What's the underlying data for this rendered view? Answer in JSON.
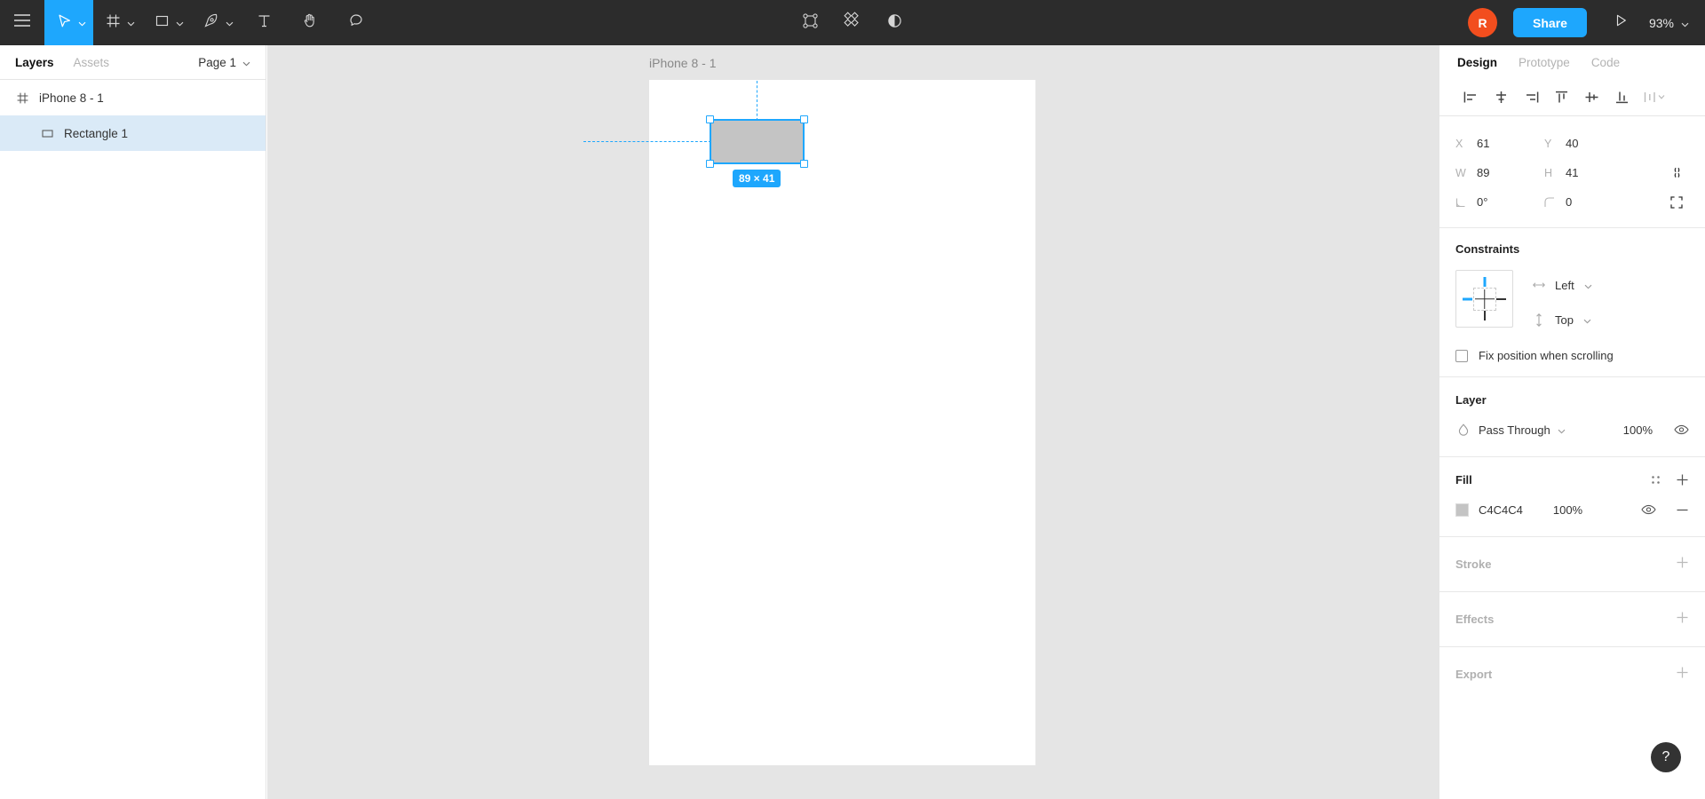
{
  "toolbar": {
    "menu_icon": "hamburger-menu-icon",
    "tools": [
      {
        "name": "move-tool",
        "icon": "cursor-arrow-icon",
        "has_caret": true,
        "active": true
      },
      {
        "name": "frame-tool",
        "icon": "frame-grid-icon",
        "has_caret": true,
        "active": false
      },
      {
        "name": "shape-tool",
        "icon": "rectangle-icon",
        "has_caret": true,
        "active": false
      },
      {
        "name": "pen-tool",
        "icon": "pen-nib-icon",
        "has_caret": true,
        "active": false
      },
      {
        "name": "text-tool",
        "icon": "text-t-icon",
        "has_caret": false,
        "active": false
      },
      {
        "name": "hand-tool",
        "icon": "hand-icon",
        "has_caret": false,
        "active": false
      },
      {
        "name": "comment-tool",
        "icon": "comment-bubble-icon",
        "has_caret": false,
        "active": false
      }
    ],
    "center_actions": [
      {
        "name": "create-component-button",
        "icon": "component-icon"
      },
      {
        "name": "component-instance-button",
        "icon": "four-diamonds-icon"
      },
      {
        "name": "mask-button",
        "icon": "half-circle-mask-icon"
      }
    ],
    "avatar_initial": "R",
    "avatar_color": "#F24E1E",
    "share_label": "Share",
    "share_color": "#1EA7FD",
    "present_icon": "play-triangle-icon",
    "zoom_level": "93%",
    "zoom_caret_icon": "chevron-down-icon",
    "background": "#2C2C2C"
  },
  "left_panel": {
    "tabs": [
      {
        "label": "Layers",
        "active": true
      },
      {
        "label": "Assets",
        "active": false
      }
    ],
    "page_name": "Page 1",
    "page_caret_icon": "chevron-down-icon",
    "layers": [
      {
        "name": "iPhone 8 - 1",
        "icon": "frame-hash-icon",
        "indent": 0,
        "selected": false
      },
      {
        "name": "Rectangle 1",
        "icon": "rectangle-outline-icon",
        "indent": 1,
        "selected": true
      }
    ],
    "selected_row_color": "#DAEAF7"
  },
  "canvas": {
    "background": "#E5E5E5",
    "frame_label": "iPhone 8 - 1",
    "frame_fill": "#FFFFFF",
    "selection": {
      "fill": "#C4C4C4",
      "stroke": "#1EA7FD",
      "dimension_badge": "89 × 41",
      "handles": [
        "top-left",
        "top-right",
        "bottom-left",
        "bottom-right"
      ]
    }
  },
  "right_panel": {
    "tabs": [
      {
        "label": "Design",
        "active": true
      },
      {
        "label": "Prototype",
        "active": false
      },
      {
        "label": "Code",
        "active": false
      }
    ],
    "align_buttons": [
      {
        "name": "align-left-icon"
      },
      {
        "name": "align-horizontal-center-icon"
      },
      {
        "name": "align-right-icon"
      },
      {
        "name": "align-top-icon"
      },
      {
        "name": "align-vertical-center-icon"
      },
      {
        "name": "align-bottom-icon"
      },
      {
        "name": "distribute-menu-icon"
      }
    ],
    "properties": {
      "x_label": "X",
      "x_value": "61",
      "y_label": "Y",
      "y_value": "40",
      "w_label": "W",
      "w_value": "89",
      "h_label": "H",
      "h_value": "41",
      "rotation_value": "0°",
      "corner_radius_value": "0",
      "constrain_proportions_icon": "link-broken-icon",
      "independent_corners_icon": "corner-expand-icon"
    },
    "constraints": {
      "title": "Constraints",
      "horizontal": "Left",
      "vertical": "Top",
      "horizontal_icon": "horizontal-arrows-icon",
      "vertical_icon": "vertical-arrows-icon",
      "caret_icon": "chevron-down-icon",
      "fix_position_label": "Fix position when scrolling",
      "fix_position_checked": false,
      "active_bar_color": "#1EA7FD"
    },
    "layer": {
      "title": "Layer",
      "blend_mode": "Pass Through",
      "blend_icon": "blend-drop-icon",
      "opacity": "100%",
      "visibility_icon": "eye-icon"
    },
    "fill": {
      "title": "Fill",
      "settings_icon": "style-dots-icon",
      "add_icon": "plus-icon",
      "color_hex": "C4C4C4",
      "color_value": "#C4C4C4",
      "opacity": "100%",
      "visibility_icon": "eye-icon",
      "remove_icon": "minus-icon"
    },
    "stroke": {
      "title": "Stroke",
      "add_icon": "plus-icon"
    },
    "effects": {
      "title": "Effects",
      "add_icon": "plus-icon"
    },
    "export": {
      "title": "Export",
      "add_icon": "plus-icon"
    },
    "help_label": "?"
  }
}
